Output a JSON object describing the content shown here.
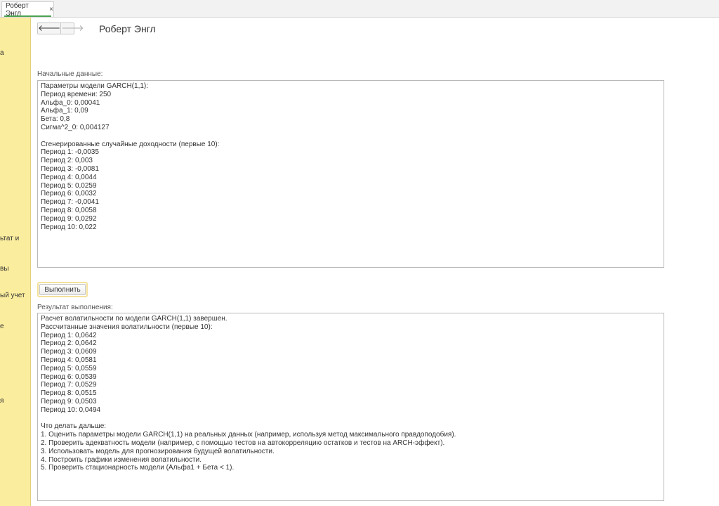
{
  "tab": {
    "label": "Роберт Энгл",
    "close": "×"
  },
  "sidebar": {
    "fragments": [
      "а",
      "ьтат и",
      "вы",
      "ый учет",
      "е",
      "я"
    ]
  },
  "header": {
    "back": "🡐",
    "forward": "🡒",
    "title": "Роберт Энгл"
  },
  "input": {
    "label": "Начальные данные:",
    "lines": [
      "Параметры модели GARCH(1,1):",
      "Период времени: 250",
      "Альфа_0: 0,00041",
      "Альфа_1: 0,09",
      "Бета: 0,8",
      "Сигма^2_0: 0,004127",
      "",
      "Сгенерированные случайные доходности (первые 10):",
      "Период 1: -0,0035",
      "Период 2: 0,003",
      "Период 3: -0,0081",
      "Период 4: 0,0044",
      "Период 5: 0,0259",
      "Период 6: 0,0032",
      "Период 7: -0,0041",
      "Период 8: 0,0058",
      "Период 9: 0,0292",
      "Период 10: 0,022"
    ]
  },
  "run_button": {
    "label": "Выполнить"
  },
  "result": {
    "label": "Результат выполнения:",
    "lines": [
      "Расчет волатильности по модели GARCH(1,1) завершен.",
      "Рассчитанные значения волатильности (первые 10):",
      "Период 1: 0,0642",
      "Период 2: 0,0642",
      "Период 3: 0,0609",
      "Период 4: 0,0581",
      "Период 5: 0,0559",
      "Период 6: 0,0539",
      "Период 7: 0,0529",
      "Период 8: 0,0515",
      "Период 9: 0,0503",
      "Период 10: 0,0494",
      "",
      "Что делать дальше:",
      "1. Оценить параметры модели GARCH(1,1) на реальных данных (например, используя метод максимального правдоподобия).",
      "2. Проверить адекватность модели (например, с помощью тестов на автокорреляцию остатков и тестов на ARCH-эффект).",
      "3. Использовать модель для прогнозирования будущей волатильности.",
      "4. Построить графики изменения волатильности.",
      "5. Проверить стационарность модели (Альфа1 + Бета < 1)."
    ]
  },
  "colors": {
    "sidebar_bg": "#fbed9e",
    "tab_accent": "#4aa352",
    "button_focus": "#f3e19a"
  }
}
